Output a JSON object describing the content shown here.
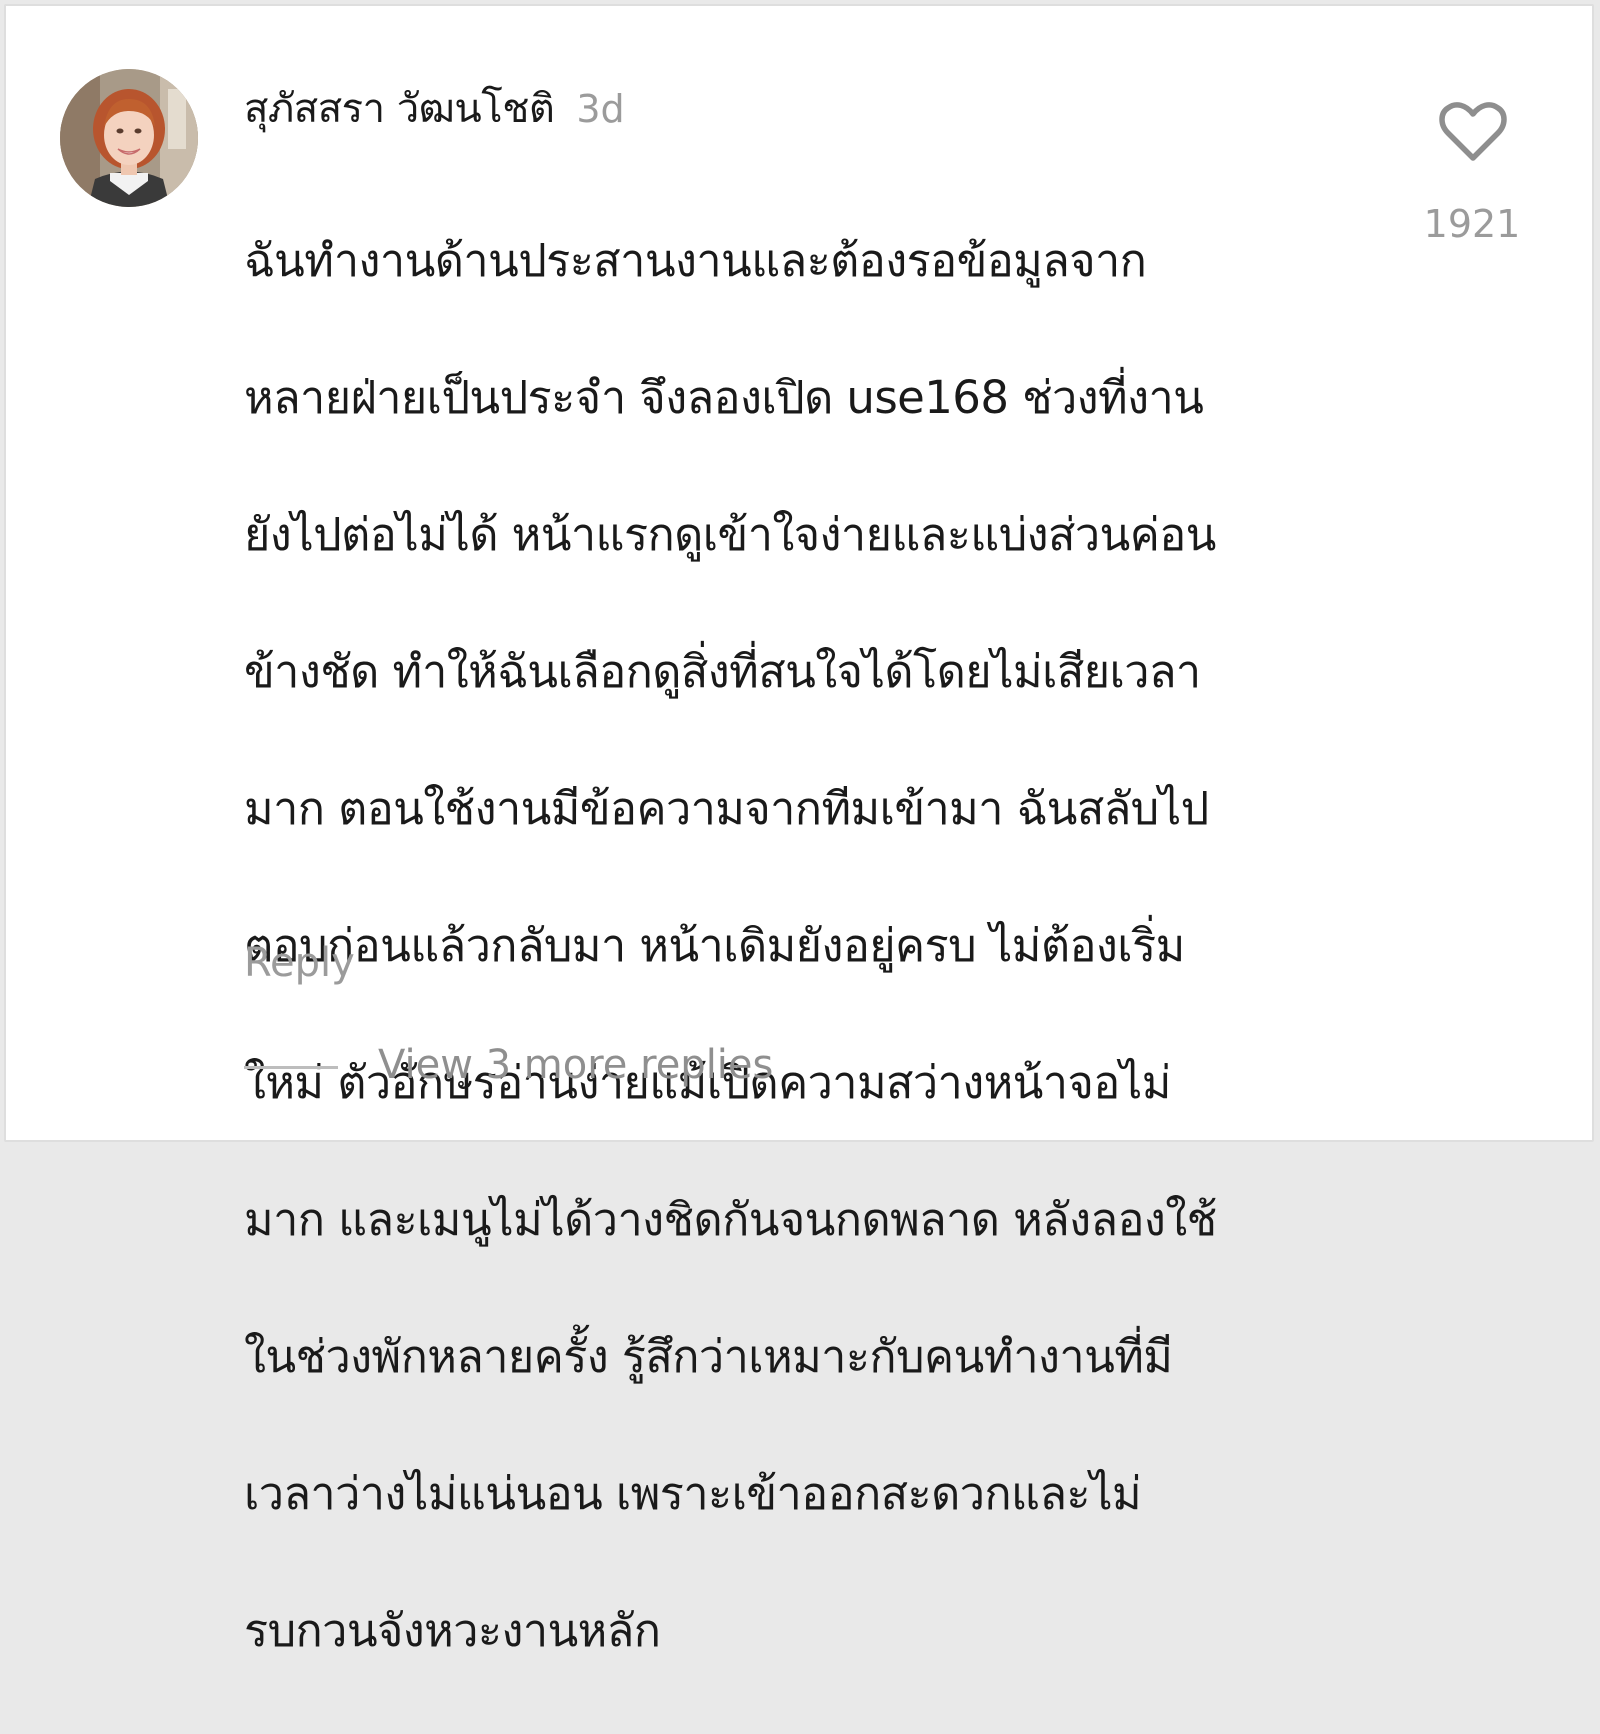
{
  "comment": {
    "username": "สุภัสสรา วัฒนโชติ",
    "time": "3d",
    "text_lines": [
      "ฉันทำงานด้านประสานงานและต้องรอข้อมูลจาก",
      "หลายฝ่ายเป็นประจำ จึงลองเปิด use168 ช่วงที่งาน",
      "ยังไปต่อไม่ได้ หน้าแรกดูเข้าใจง่ายและแบ่งส่วนค่อน",
      "ข้างชัด ทำให้ฉันเลือกดูสิ่งที่สนใจได้โดยไม่เสียเวลา",
      "มาก ตอนใช้งานมีข้อความจากทีมเข้ามา ฉันสลับไป",
      "ตอบก่อนแล้วกลับมา หน้าเดิมยังอยู่ครบ ไม่ต้องเริ่ม",
      "ใหม่ ตัวอักษรอ่านง่ายแม้เปิดความสว่างหน้าจอไม่",
      "มาก และเมนูไม่ได้วางชิดกันจนกดพลาด หลังลองใช้",
      "ในช่วงพักหลายครั้ง รู้สึกว่าเหมาะกับคนทำงานที่มี",
      "เวลาว่างไม่แน่นอน เพราะเข้าออกสะดวกและไม่",
      "รบกวนจังหวะงานหลัก"
    ],
    "like_count": "1921",
    "like_icon": "heart-outline-icon",
    "reply_label": "Reply",
    "view_replies_label": "View 3 more replies"
  },
  "colors": {
    "text_primary": "#1a1a1a",
    "text_secondary": "#9b9b9b",
    "background": "#ffffff"
  }
}
